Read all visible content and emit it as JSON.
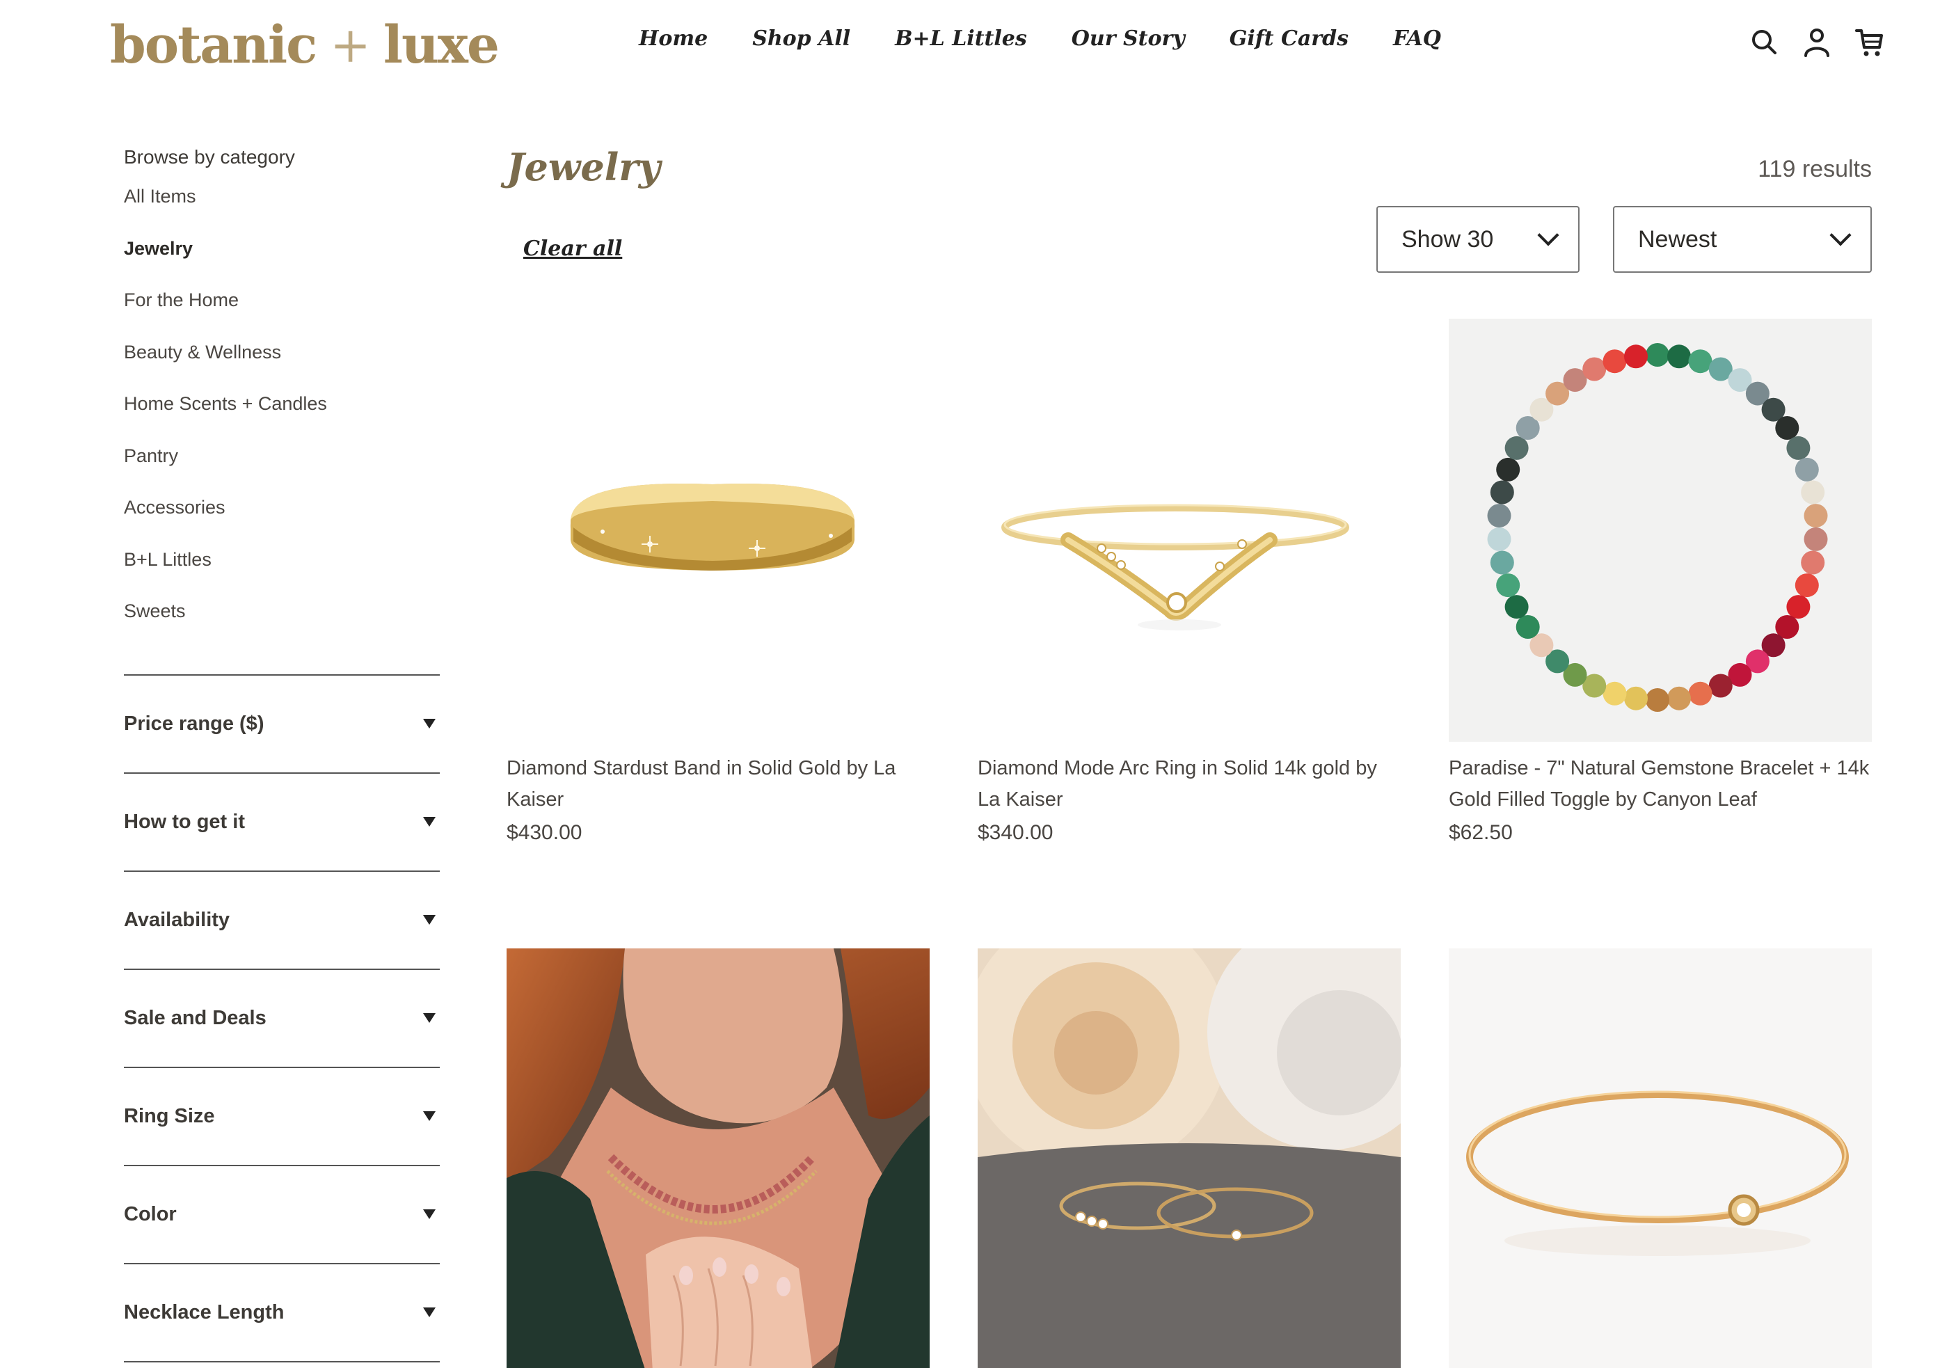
{
  "header": {
    "logo_left": "botanic",
    "logo_plus": "+",
    "logo_right": "luxe",
    "nav": [
      "Home",
      "Shop All",
      "B+L Littles",
      "Our Story",
      "Gift Cards",
      "FAQ"
    ],
    "icons": [
      "search-icon",
      "account-icon",
      "cart-icon"
    ]
  },
  "sidebar": {
    "title": "Browse by category",
    "categories": [
      "All Items",
      "Jewelry",
      "For the Home",
      "Beauty & Wellness",
      "Home Scents + Candles",
      "Pantry",
      "Accessories",
      "B+L Littles",
      "Sweets"
    ],
    "active_category": "Jewelry",
    "filters": [
      "Price range ($)",
      "How to get it",
      "Availability",
      "Sale and Deals",
      "Ring Size",
      "Color",
      "Necklace Length"
    ]
  },
  "main": {
    "title": "Jewelry",
    "results": "119 results",
    "clear_all": "Clear all",
    "show_value": "Show 30",
    "sort_value": "Newest",
    "products": [
      {
        "name": "Diamond Stardust Band in Solid Gold by La Kaiser",
        "price": "$430.00"
      },
      {
        "name": "Diamond Mode Arc Ring in Solid 14k gold by La Kaiser",
        "price": "$340.00"
      },
      {
        "name": "Paradise - 7\" Natural Gemstone Bracelet + 14k Gold Filled Toggle by Canyon Leaf",
        "price": "$62.50"
      },
      {
        "name": "",
        "price": ""
      },
      {
        "name": "",
        "price": ""
      },
      {
        "name": "",
        "price": ""
      }
    ]
  },
  "colors": {
    "brand_gold": "#a48a5a",
    "title_olive": "#7a6b4c",
    "text": "#3d3a36"
  }
}
